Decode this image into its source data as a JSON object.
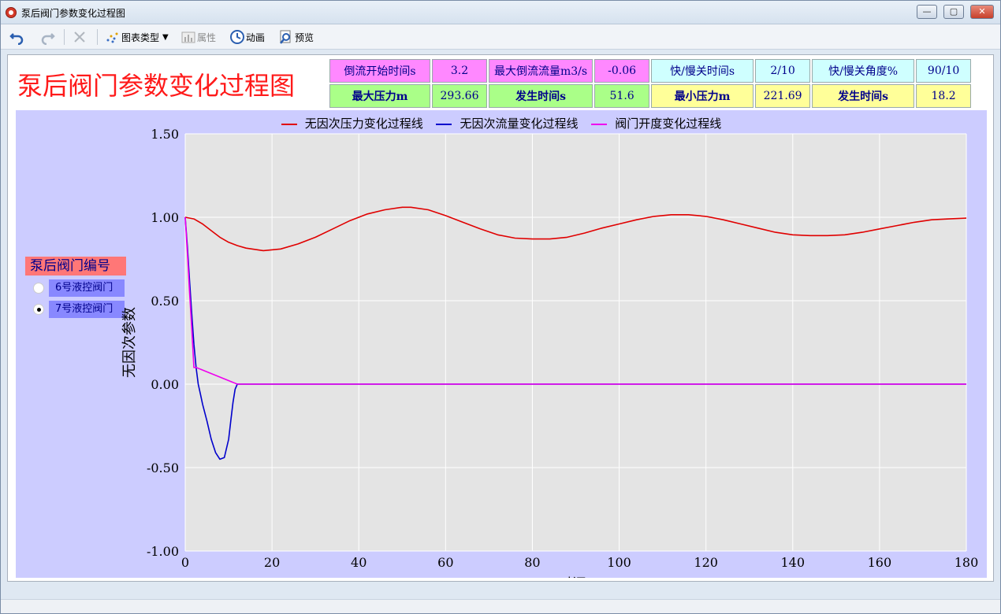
{
  "window": {
    "title": "泵后阀门参数变化过程图",
    "buttons": {
      "minimize": "—",
      "maximize": "▢",
      "close": "✕"
    }
  },
  "toolbar": {
    "undo_icon": "undo-icon",
    "redo_icon": "redo-icon",
    "delete_icon": "delete-icon",
    "chart_type_label": "图表类型",
    "properties_label": "属性",
    "animation_label": "动画",
    "preview_label": "预览"
  },
  "header": {
    "title": "泵后阀门参数变化过程图"
  },
  "info_table": {
    "row1": [
      {
        "text": "倒流开始时间s",
        "style": "pink"
      },
      {
        "text": "3.2",
        "style": "pink"
      },
      {
        "text": "最大倒流流量m3/s",
        "style": "pink"
      },
      {
        "text": "-0.06",
        "style": "pink"
      },
      {
        "text": "快/慢关时间s",
        "style": "cyan"
      },
      {
        "text": "2/10",
        "style": "cyan"
      },
      {
        "text": "快/慢关角度%",
        "style": "cyan"
      },
      {
        "text": "90/10",
        "style": "cyan"
      }
    ],
    "row2": [
      {
        "text": "最大压力m",
        "style": "green"
      },
      {
        "text": "293.66",
        "style": "green"
      },
      {
        "text": "发生时间s",
        "style": "green"
      },
      {
        "text": "51.6",
        "style": "green"
      },
      {
        "text": "最小压力m",
        "style": "yellow"
      },
      {
        "text": "221.69",
        "style": "yellow"
      },
      {
        "text": "发生时间s",
        "style": "yellow"
      },
      {
        "text": "18.2",
        "style": "yellow"
      }
    ]
  },
  "valve_selector": {
    "heading": "泵后阀门编号",
    "options": [
      {
        "label": "6号液控阀门",
        "checked": false
      },
      {
        "label": "7号液控阀门",
        "checked": true
      }
    ]
  },
  "chart_data": {
    "type": "line",
    "xlabel": "时间s",
    "ylabel": "无因次参数",
    "xlim": [
      0,
      180
    ],
    "ylim": [
      -1.0,
      1.5
    ],
    "xticks": [
      "0",
      "20",
      "40",
      "60",
      "80",
      "100",
      "120",
      "140",
      "160",
      "180"
    ],
    "yticks": [
      "1.50",
      "1.00",
      "0.50",
      "0.00",
      "-0.50",
      "-1.00"
    ],
    "grid": true,
    "legend_position": "top",
    "colors": {
      "pressure": "#e00000",
      "flow": "#0000cc",
      "valve": "#ee00ee",
      "plot_bg": "#e4e4e4"
    },
    "series": [
      {
        "name": "无因次压力变化过程线",
        "color": "#e00000",
        "x": [
          0,
          2,
          4,
          6,
          8,
          10,
          12,
          14,
          18,
          22,
          26,
          30,
          34,
          38,
          42,
          46,
          50,
          52,
          56,
          60,
          64,
          68,
          72,
          76,
          80,
          84,
          88,
          92,
          96,
          100,
          104,
          108,
          112,
          116,
          120,
          124,
          128,
          132,
          136,
          140,
          144,
          148,
          152,
          156,
          160,
          164,
          168,
          172,
          176,
          180
        ],
        "values": [
          1.0,
          0.99,
          0.96,
          0.92,
          0.88,
          0.85,
          0.83,
          0.815,
          0.8,
          0.81,
          0.84,
          0.88,
          0.93,
          0.98,
          1.02,
          1.045,
          1.06,
          1.06,
          1.045,
          1.01,
          0.97,
          0.93,
          0.895,
          0.875,
          0.87,
          0.87,
          0.88,
          0.905,
          0.935,
          0.96,
          0.985,
          1.005,
          1.015,
          1.015,
          1.005,
          0.985,
          0.96,
          0.935,
          0.91,
          0.895,
          0.89,
          0.89,
          0.895,
          0.91,
          0.93,
          0.95,
          0.97,
          0.985,
          0.99,
          0.995
        ]
      },
      {
        "name": "无因次流量变化过程线",
        "color": "#0000cc",
        "x": [
          0,
          0.5,
          1,
          1.5,
          2,
          2.5,
          3,
          3.5,
          4,
          5,
          6,
          7,
          8,
          9,
          10,
          10.5,
          11,
          11.5,
          12,
          14,
          20,
          40,
          60,
          80,
          100,
          120,
          140,
          160,
          180
        ],
        "values": [
          1.0,
          0.82,
          0.62,
          0.42,
          0.24,
          0.1,
          0.0,
          -0.06,
          -0.12,
          -0.22,
          -0.33,
          -0.41,
          -0.45,
          -0.44,
          -0.33,
          -0.22,
          -0.11,
          -0.03,
          0.0,
          0.0,
          0.0,
          0.0,
          0.0,
          0.0,
          0.0,
          0.0,
          0.0,
          0.0,
          0.0
        ]
      },
      {
        "name": "阀门开度变化过程线",
        "color": "#ee00ee",
        "x": [
          0,
          0.5,
          1,
          1.5,
          2,
          2.5,
          12,
          20,
          40,
          60,
          80,
          100,
          120,
          140,
          160,
          180
        ],
        "values": [
          1.0,
          0.78,
          0.55,
          0.33,
          0.1,
          0.1,
          0.0,
          0.0,
          0.0,
          0.0,
          0.0,
          0.0,
          0.0,
          0.0,
          0.0,
          0.0
        ]
      }
    ]
  }
}
